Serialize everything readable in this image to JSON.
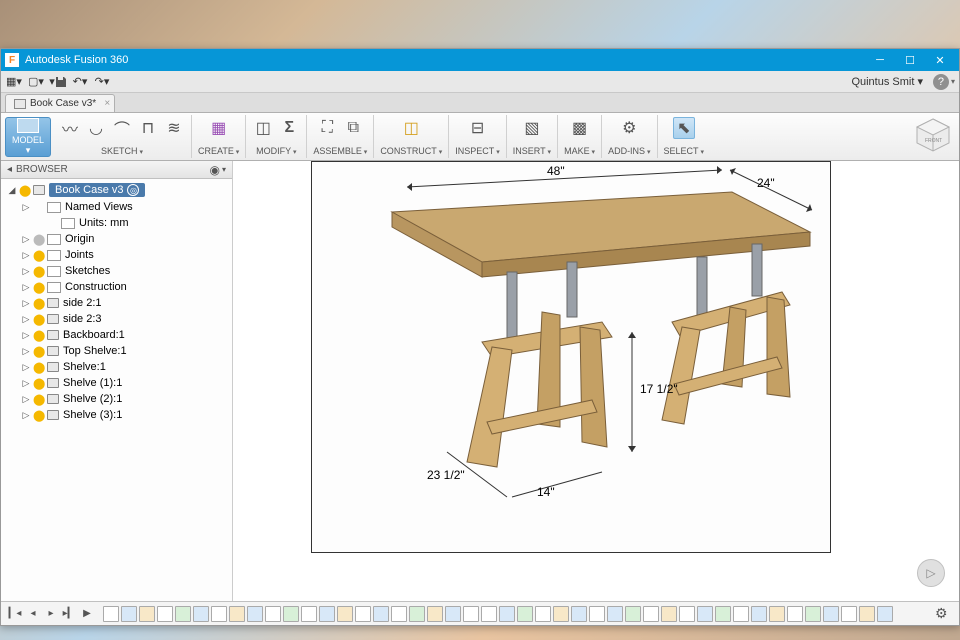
{
  "app": {
    "title": "Autodesk Fusion 360",
    "icon_letter": "F"
  },
  "user": "Quintus Smit",
  "tab": {
    "name": "Book Case v3*"
  },
  "ribbon": {
    "model": "MODEL",
    "groups": {
      "sketch": "SKETCH",
      "create": "CREATE",
      "modify": "MODIFY",
      "assemble": "ASSEMBLE",
      "construct": "CONSTRUCT",
      "inspect": "INSPECT",
      "insert": "INSERT",
      "make": "MAKE",
      "addins": "ADD-INS",
      "select": "SELECT"
    }
  },
  "browser": {
    "title": "BROWSER",
    "root": "Book Case v3",
    "nodes": [
      {
        "label": "Named Views",
        "bulb": "",
        "indent": 1,
        "icon": "folder"
      },
      {
        "label": "Units: mm",
        "bulb": "",
        "indent": 2,
        "icon": "folder"
      },
      {
        "label": "Origin",
        "bulb": "off",
        "indent": 1,
        "icon": "folder"
      },
      {
        "label": "Joints",
        "bulb": "on",
        "indent": 1,
        "icon": "folder"
      },
      {
        "label": "Sketches",
        "bulb": "on",
        "indent": 1,
        "icon": "folder"
      },
      {
        "label": "Construction",
        "bulb": "on",
        "indent": 1,
        "icon": "folder"
      },
      {
        "label": "side 2:1",
        "bulb": "on",
        "indent": 1,
        "icon": "comp"
      },
      {
        "label": "side 2:3",
        "bulb": "on",
        "indent": 1,
        "icon": "comp"
      },
      {
        "label": "Backboard:1",
        "bulb": "on",
        "indent": 1,
        "icon": "comp"
      },
      {
        "label": "Top Shelve:1",
        "bulb": "on",
        "indent": 1,
        "icon": "comp"
      },
      {
        "label": "Shelve:1",
        "bulb": "on",
        "indent": 1,
        "icon": "comp"
      },
      {
        "label": "Shelve (1):1",
        "bulb": "on",
        "indent": 1,
        "icon": "comp"
      },
      {
        "label": "Shelve (2):1",
        "bulb": "on",
        "indent": 1,
        "icon": "comp"
      },
      {
        "label": "Shelve (3):1",
        "bulb": "on",
        "indent": 1,
        "icon": "comp"
      }
    ]
  },
  "dimensions": {
    "width": "48\"",
    "depth": "24\"",
    "post_height": "17 1/2\"",
    "base_depth": "23 1/2\"",
    "base_width": "14\""
  },
  "timeline_count": 44
}
